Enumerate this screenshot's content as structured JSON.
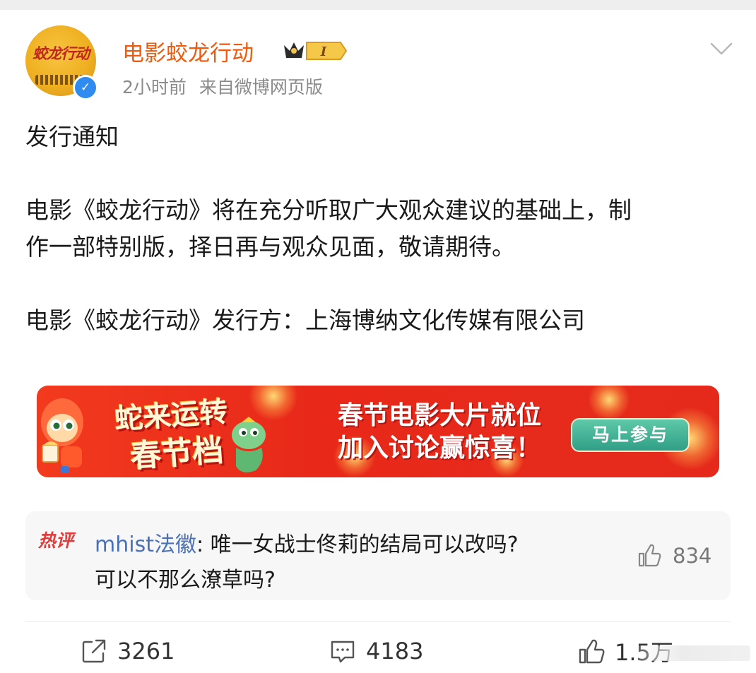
{
  "post": {
    "author": {
      "name": "电影蛟龙行动",
      "vip_level": "I",
      "avatar_text": "蛟龙行动"
    },
    "time": "2小时前",
    "source": "来自微博网页版",
    "paragraphs": [
      "发行通知",
      "电影《蛟龙行动》将在充分听取广大观众建议的基础上，制",
      "作一部特别版，择日再与观众见面，敬请期待。",
      "电影《蛟龙行动》发行方：上海博纳文化传媒有限公司"
    ]
  },
  "banner": {
    "logo_line1": "蛇来运转",
    "logo_line2": "春节档",
    "title_line1": "春节电影大片就位",
    "title_line2": "加入讨论赢惊喜！",
    "cta_label": "马上参与"
  },
  "hot_comment": {
    "tag": "热评",
    "user": "mhist法徽",
    "text_line1": ": 唯一女战士佟莉的结局可以改吗?",
    "text_line2": "可以不那么潦草吗?",
    "likes": "834"
  },
  "actions": {
    "reposts": "3261",
    "comments": "4183",
    "likes": "1.5万"
  },
  "colors": {
    "username": "#f15a0c",
    "hot_user": "#4a71b8",
    "banner_red": "#e8291a",
    "cta_green": "#2f9f86",
    "verified_blue": "#2f8bf0"
  }
}
